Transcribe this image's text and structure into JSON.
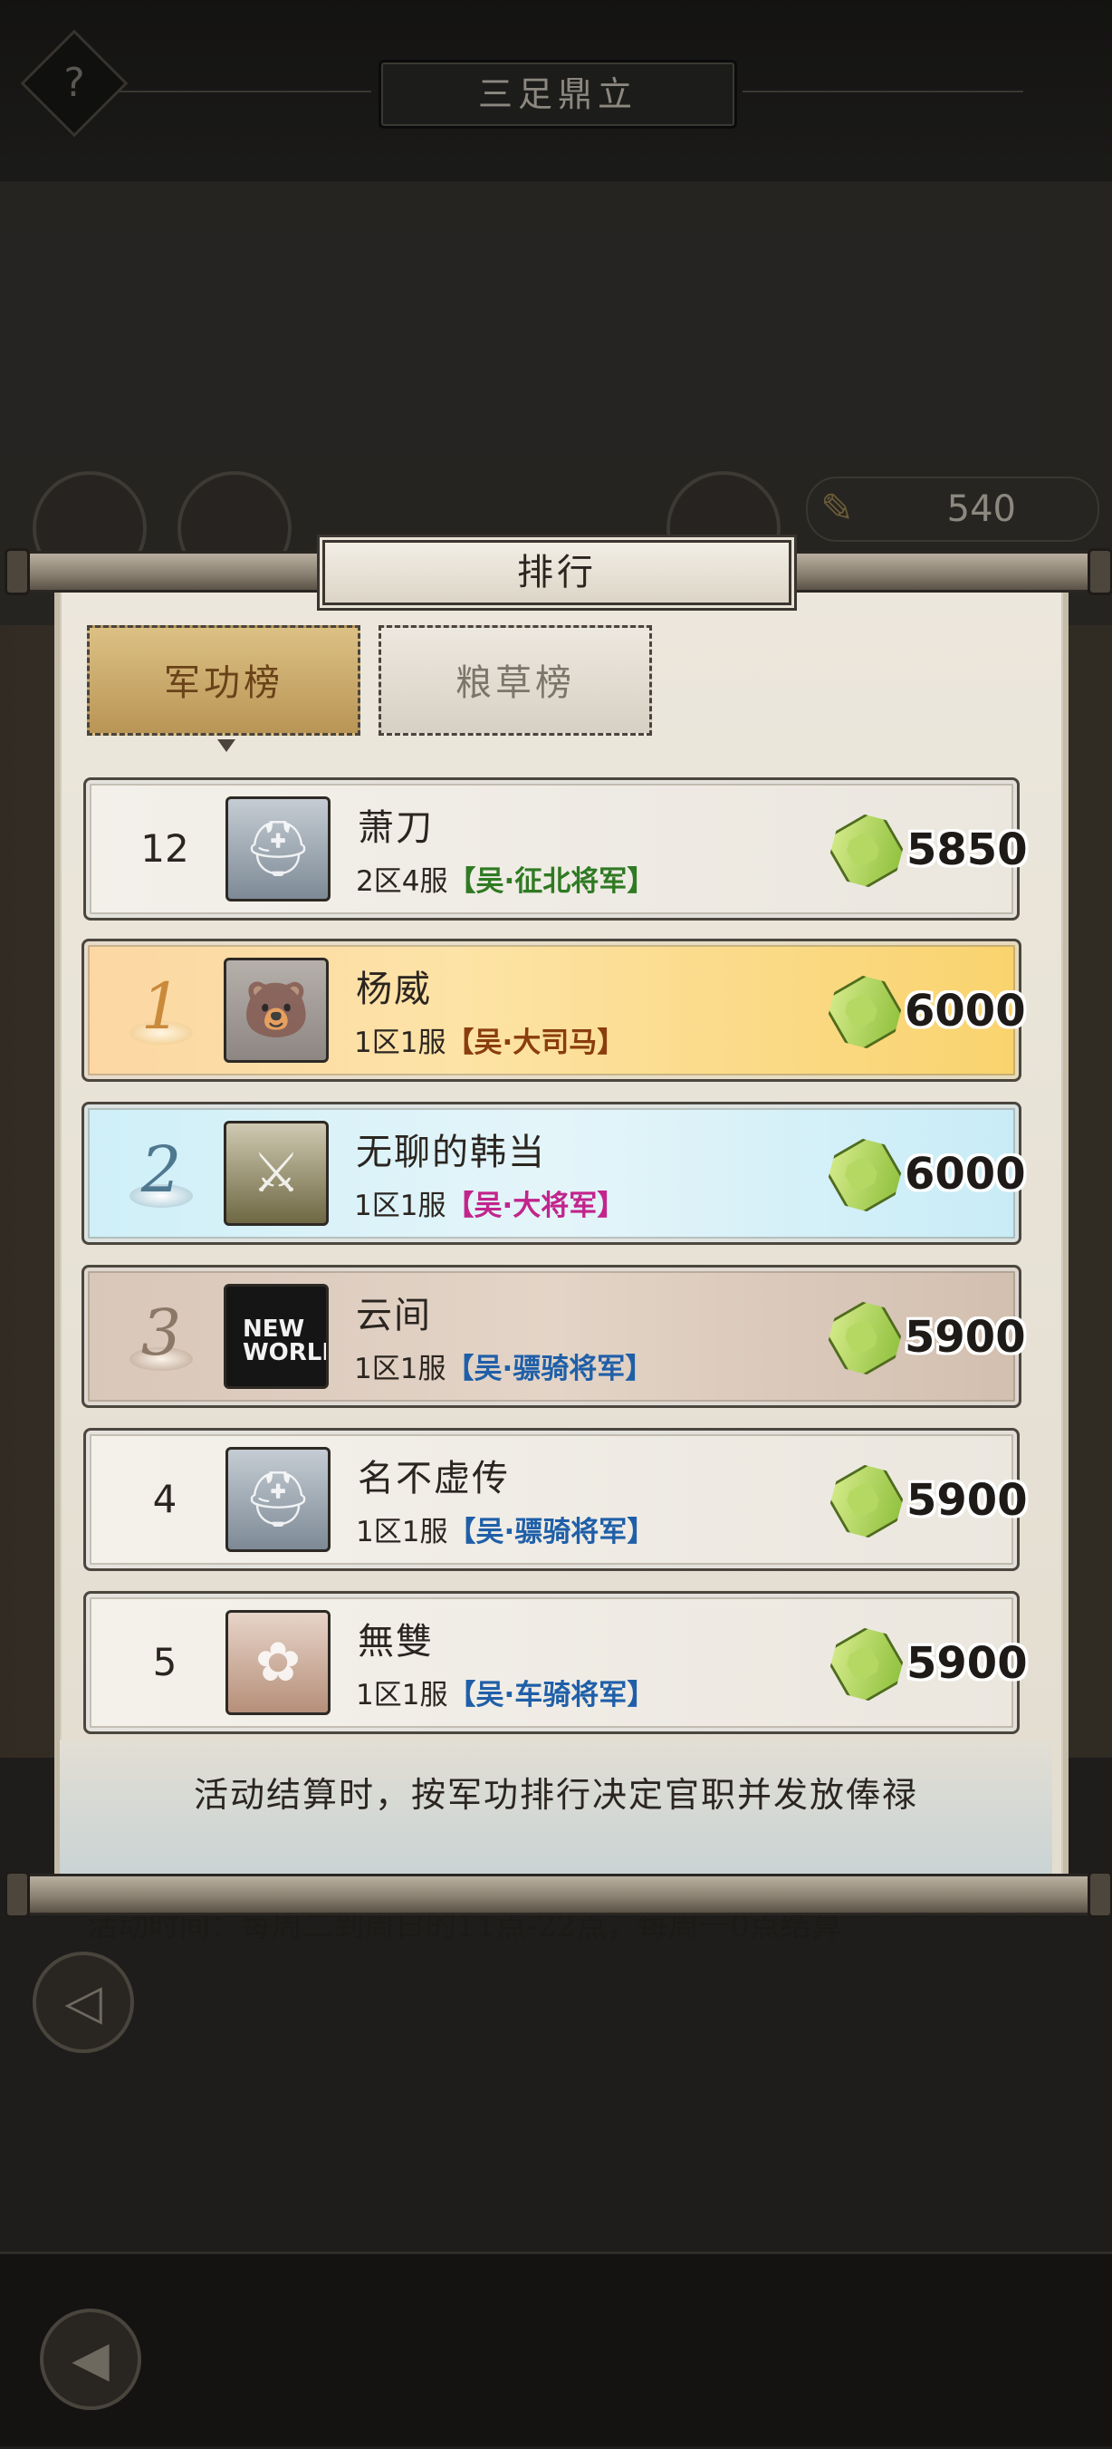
{
  "header": {
    "help_icon": "?",
    "title": "三足鼎立"
  },
  "resource": {
    "icon": "feather-icon",
    "value": "540"
  },
  "background_info": "活动时间：每周二到周日的11点-22点，每周一0点结算",
  "dialog": {
    "title": "排行",
    "tabs": [
      {
        "label": "军功榜",
        "active": true
      },
      {
        "label": "粮草榜",
        "active": false
      }
    ],
    "self_row": {
      "rank": "12",
      "name": "萧刀",
      "server": "2区4服",
      "title": "【吴·征北将军】",
      "title_color": "#2f7a23",
      "score": "5850"
    },
    "rows": [
      {
        "rank": "1",
        "name": "杨威",
        "server": "1区1服",
        "title": "【吴·大司马】",
        "title_color": "#8a3d0e",
        "score": "6000"
      },
      {
        "rank": "2",
        "name": "无聊的韩当",
        "server": "1区1服",
        "title": "【吴·大将军】",
        "title_color": "#c2248c",
        "score": "6000"
      },
      {
        "rank": "3",
        "name": "云间",
        "server": "1区1服",
        "title": "【吴·骠骑将军】",
        "title_color": "#1f5fa8",
        "score": "5900"
      },
      {
        "rank": "4",
        "name": "名不虚传",
        "server": "1区1服",
        "title": "【吴·骠骑将军】",
        "title_color": "#1f5fa8",
        "score": "5900"
      },
      {
        "rank": "5",
        "name": "無雙",
        "server": "1区1服",
        "title": "【吴·车骑将军】",
        "title_color": "#1f5fa8",
        "score": "5900"
      }
    ],
    "footnote": "活动结算时，按军功排行决定官职并发放俸禄"
  },
  "colors": {
    "active_tab": "#c9a867",
    "rank1_row": "#fde3a6",
    "rank2_row": "#d9f2f9",
    "rank3_row": "#ddcbbd"
  }
}
